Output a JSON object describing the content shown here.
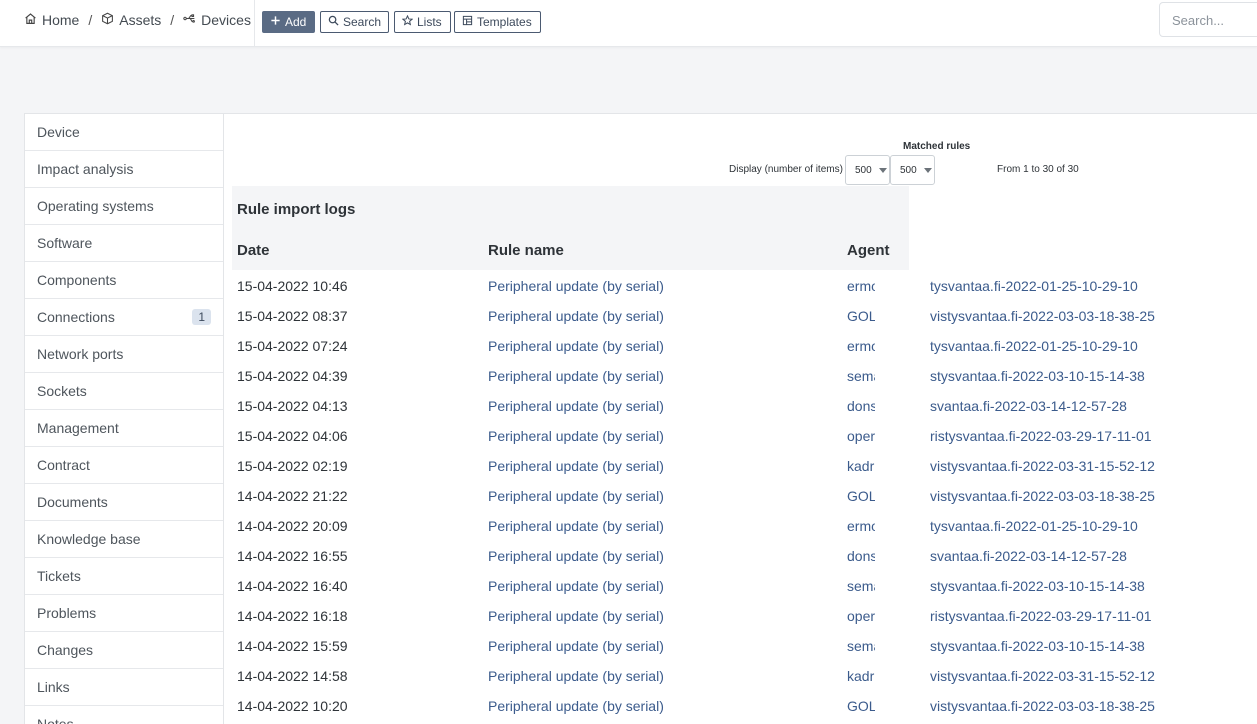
{
  "breadcrumb": {
    "home": "Home",
    "assets": "Assets",
    "devices": "Devices",
    "separator": "/"
  },
  "toolbar": {
    "add_label": "Add",
    "search_label": "Search",
    "lists_label": "Lists",
    "templates_label": "Templates"
  },
  "global_search": {
    "placeholder": "Search..."
  },
  "sidebar": {
    "items": [
      {
        "label": "Device"
      },
      {
        "label": "Impact analysis"
      },
      {
        "label": "Operating systems"
      },
      {
        "label": "Software"
      },
      {
        "label": "Components"
      },
      {
        "label": "Connections",
        "badge": "1"
      },
      {
        "label": "Network ports"
      },
      {
        "label": "Sockets"
      },
      {
        "label": "Management"
      },
      {
        "label": "Contract"
      },
      {
        "label": "Documents"
      },
      {
        "label": "Knowledge base"
      },
      {
        "label": "Tickets"
      },
      {
        "label": "Problems"
      },
      {
        "label": "Changes"
      },
      {
        "label": "Links"
      },
      {
        "label": "Notes"
      }
    ]
  },
  "pager": {
    "matched_rules": "Matched rules",
    "display_label": "Display (number of items)",
    "select_1": "500",
    "select_2": "500",
    "range_text": "From 1 to 30 of 30"
  },
  "logs": {
    "title": "Rule import logs",
    "columns": {
      "date": "Date",
      "rule": "Rule name",
      "agent": "Agent"
    },
    "rows": [
      {
        "date": "15-04-2022 10:46",
        "rule": "Peripheral update (by serial)",
        "agent": "ermo",
        "host": "tysvantaa.fi-2022-01-25-10-29-10"
      },
      {
        "date": "15-04-2022 08:37",
        "rule": "Peripheral update (by serial)",
        "agent": "GOL",
        "host": "vistysvantaa.fi-2022-03-03-18-38-25"
      },
      {
        "date": "15-04-2022 07:24",
        "rule": "Peripheral update (by serial)",
        "agent": "ermo",
        "host": "tysvantaa.fi-2022-01-25-10-29-10"
      },
      {
        "date": "15-04-2022 04:39",
        "rule": "Peripheral update (by serial)",
        "agent": "sema",
        "host": "stysvantaa.fi-2022-03-10-15-14-38"
      },
      {
        "date": "15-04-2022 04:13",
        "rule": "Peripheral update (by serial)",
        "agent": "dons",
        "host": "svantaa.fi-2022-03-14-12-57-28"
      },
      {
        "date": "15-04-2022 04:06",
        "rule": "Peripheral update (by serial)",
        "agent": "oper",
        "host": "ristysvantaa.fi-2022-03-29-17-11-01"
      },
      {
        "date": "15-04-2022 02:19",
        "rule": "Peripheral update (by serial)",
        "agent": "kadr",
        "host": "vistysvantaa.fi-2022-03-31-15-52-12"
      },
      {
        "date": "14-04-2022 21:22",
        "rule": "Peripheral update (by serial)",
        "agent": "GOL",
        "host": "vistysvantaa.fi-2022-03-03-18-38-25"
      },
      {
        "date": "14-04-2022 20:09",
        "rule": "Peripheral update (by serial)",
        "agent": "ermo",
        "host": "tysvantaa.fi-2022-01-25-10-29-10"
      },
      {
        "date": "14-04-2022 16:55",
        "rule": "Peripheral update (by serial)",
        "agent": "dons",
        "host": "svantaa.fi-2022-03-14-12-57-28"
      },
      {
        "date": "14-04-2022 16:40",
        "rule": "Peripheral update (by serial)",
        "agent": "sema",
        "host": "stysvantaa.fi-2022-03-10-15-14-38"
      },
      {
        "date": "14-04-2022 16:18",
        "rule": "Peripheral update (by serial)",
        "agent": "oper",
        "host": "ristysvantaa.fi-2022-03-29-17-11-01"
      },
      {
        "date": "14-04-2022 15:59",
        "rule": "Peripheral update (by serial)",
        "agent": "sema",
        "host": "stysvantaa.fi-2022-03-10-15-14-38"
      },
      {
        "date": "14-04-2022 14:58",
        "rule": "Peripheral update (by serial)",
        "agent": "kadr",
        "host": "vistysvantaa.fi-2022-03-31-15-52-12"
      },
      {
        "date": "14-04-2022 10:20",
        "rule": "Peripheral update (by serial)",
        "agent": "GOL",
        "host": "vistysvantaa.fi-2022-03-03-18-38-25"
      }
    ]
  },
  "icons": {
    "home": "home-icon",
    "assets": "cube-icon",
    "devices": "usb-icon",
    "add": "plus-icon",
    "search": "search-icon",
    "lists": "star-icon",
    "templates": "template-icon"
  },
  "colors": {
    "accent": "#5a6b84",
    "link": "#3b5b8c",
    "background": "#f4f5f7"
  }
}
